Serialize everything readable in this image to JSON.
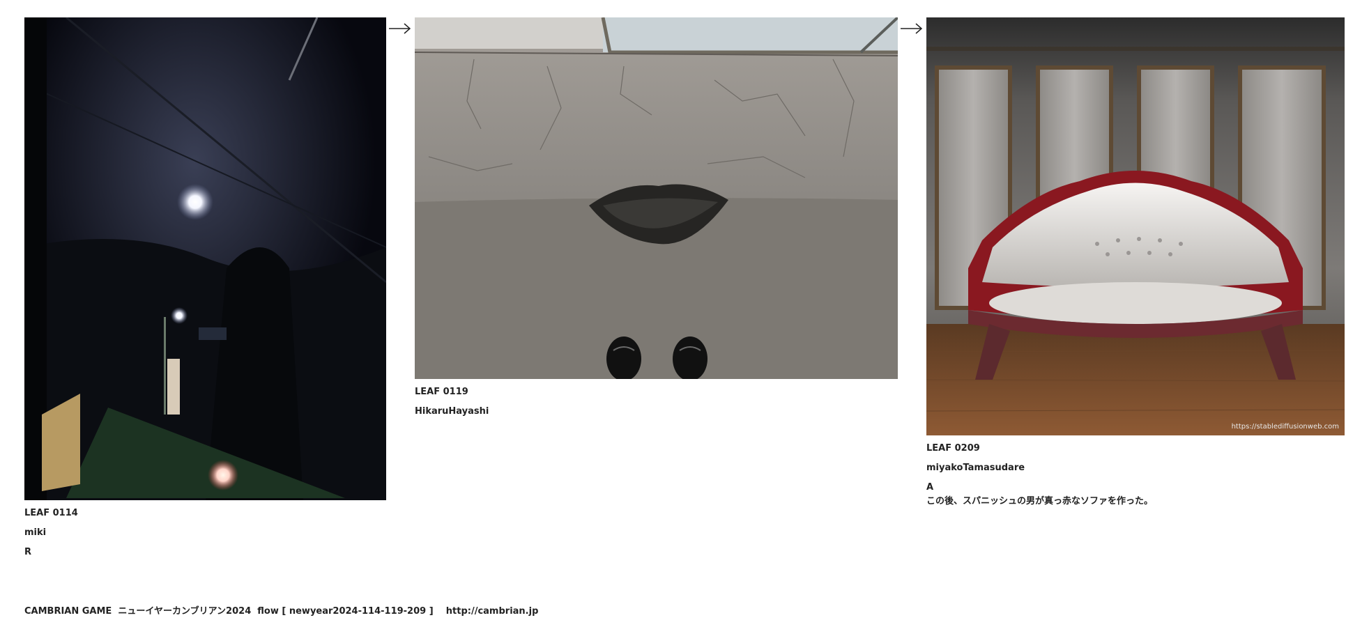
{
  "leaves": [
    {
      "id_label": "LEAF 0114",
      "author": "miki",
      "mark": "R",
      "photo_desc_icon": "night-street-moon-image"
    },
    {
      "id_label": "LEAF 0119",
      "author": "HikaruHayashi",
      "photo_desc_icon": "pavement-puddle-shoes-image"
    },
    {
      "id_label": "LEAF 0209",
      "author": "miyakoTamasudare",
      "mark": "A",
      "text": "この後、スパニッシュの男が真っ赤なソファを作った。",
      "watermark": "https://stablediffusionweb.com",
      "photo_desc_icon": "victorian-sofa-image"
    }
  ],
  "footer": {
    "text": "CAMBRIAN GAME  ニューイヤーカンブリアン2024  flow [ newyear2024-114-119-209 ]    http://cambrian.jp"
  },
  "colors": {
    "text": "#222222",
    "background": "#ffffff"
  }
}
